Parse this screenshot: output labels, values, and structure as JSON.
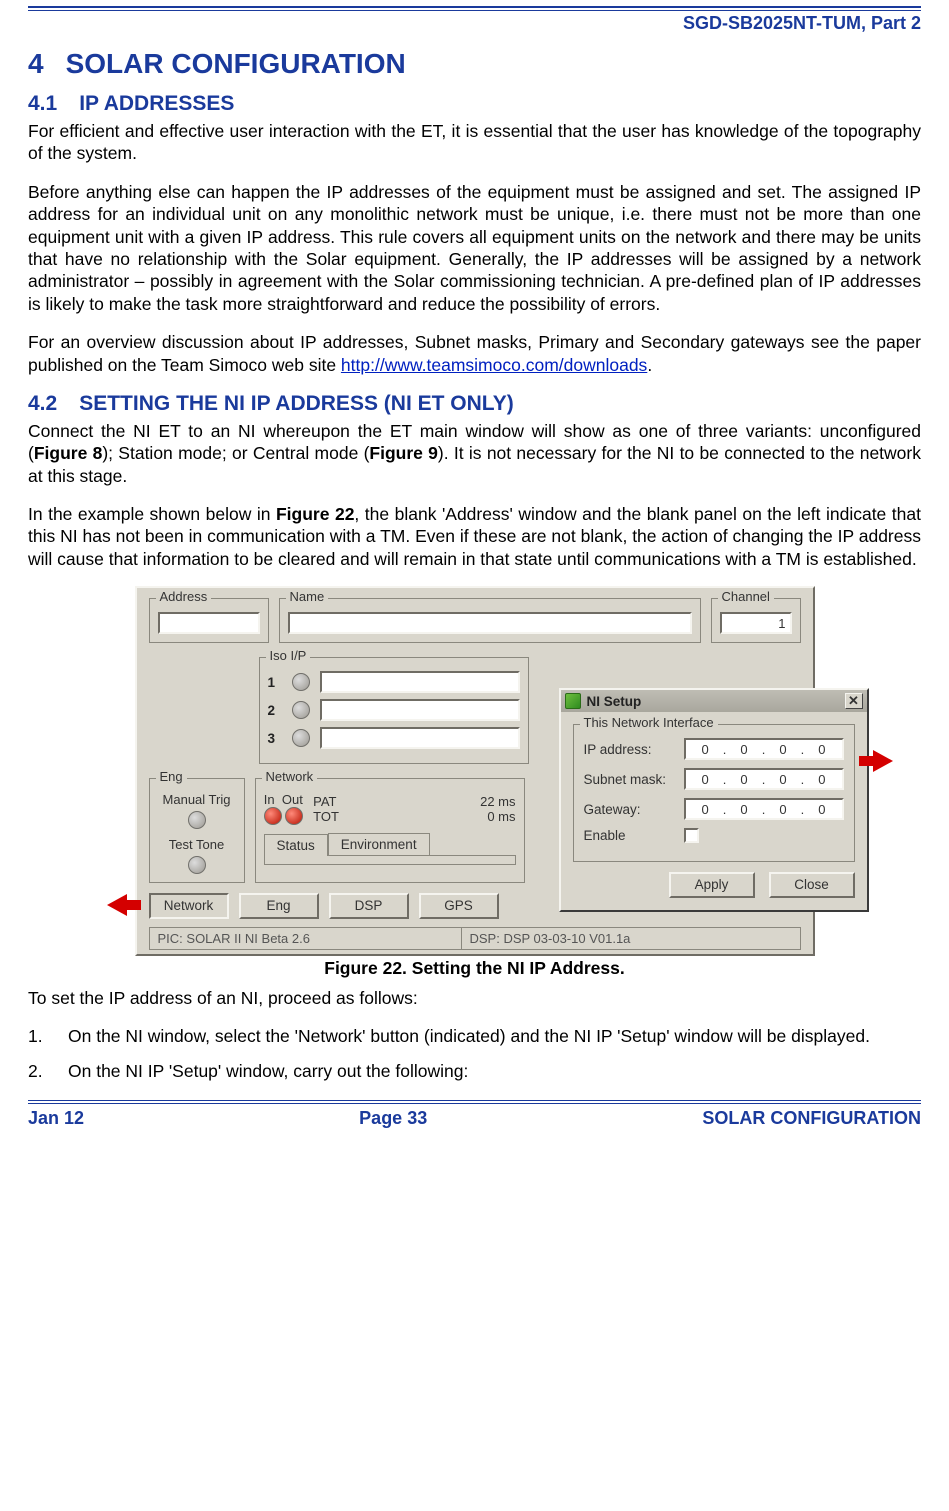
{
  "header": {
    "doc_id": "SGD-SB2025NT-TUM, Part 2"
  },
  "h1": {
    "num": "4",
    "title": "SOLAR CONFIGURATION"
  },
  "s41": {
    "num": "4.1",
    "title_a": "IP A",
    "title_b": "DDRESSES",
    "p1": "For efficient and effective user interaction with the ET, it is essential that the user has knowledge of the topography of the system.",
    "p2": "Before anything else can happen the IP addresses of the equipment must be assigned and set. The assigned IP address for an individual unit on any monolithic network must be unique, i.e. there must not be more than one equipment unit with a given IP address.  This rule covers all equipment units on the network and there may be units that have no relationship with the Solar equipment. Generally, the IP addresses will be assigned by a network administrator – possibly in agreement with the Solar commissioning technician.  A pre-defined plan of IP addresses is likely to make the task more straightforward and reduce the possibility of errors.",
    "p3a": "For an overview discussion about IP addresses, Subnet masks, Primary and Secondary gateways see the paper published on the Team Simoco web site ",
    "p3b_link": "http://www.teamsimoco.com/downloads",
    "p3c": "."
  },
  "s42": {
    "num": "4.2",
    "title_a": "S",
    "title_b": "ETTING ",
    "title_c": "T",
    "title_d": "HE ",
    "title_e": "NI IP A",
    "title_f": "DDRESS ",
    "title_g": "(NI ET O",
    "title_h": "NLY",
    "title_i": ")",
    "p1a": "Connect the NI ET to an NI whereupon the ET main window will show as one of three variants: unconfigured (",
    "p1b": "Figure 8",
    "p1c": "); Station mode; or Central mode (",
    "p1d": "Figure 9",
    "p1e": ").  It is not necessary for the NI to be connected to the network at this stage.",
    "p2a": "In the example shown below in ",
    "p2b": "Figure 22",
    "p2c": ", the blank 'Address' window and the blank panel on the left indicate that this NI has not been in communication with a TM.  Even if these are not blank, the action of changing the IP address will cause that information to be cleared and will remain in that state until communications with a TM is established."
  },
  "figure": {
    "caption": "Figure 22.  Setting the NI IP Address.",
    "groups": {
      "address": "Address",
      "name": "Name",
      "channel": "Channel",
      "channel_value": "1",
      "iso": "Iso I/P",
      "iso_rows": [
        "1",
        "2",
        "3"
      ],
      "eng_group": "Eng",
      "manual_trig": "Manual Trig",
      "test_tone": "Test Tone",
      "network": "Network",
      "net_in": "In",
      "net_out": "Out",
      "pat": "PAT",
      "pat_val": "22 ms",
      "tot": "TOT",
      "tot_val": "0 ms",
      "status_tab": "Status",
      "env_tab": "Environment"
    },
    "buttons": {
      "network": "Network",
      "eng": "Eng",
      "dsp": "DSP",
      "gps": "GPS"
    },
    "statusbar": {
      "pic": "PIC: SOLAR II NI Beta 2.6",
      "dsp": "DSP: DSP 03-03-10 V01.1a"
    },
    "ni_dialog": {
      "title": "NI Setup",
      "group": "This Network Interface",
      "ip_label": "IP address:",
      "subnet_label": "Subnet mask:",
      "gateway_label": "Gateway:",
      "enable_label": "Enable",
      "ip": [
        "0",
        "0",
        "0",
        "0"
      ],
      "subnet": [
        "0",
        "0",
        "0",
        "0"
      ],
      "gateway": [
        "0",
        "0",
        "0",
        "0"
      ],
      "apply": "Apply",
      "close": "Close"
    }
  },
  "after_fig": {
    "p": "To set the IP address of an NI, proceed as follows:",
    "step1": "On the NI window, select the 'Network' button (indicated) and the NI IP 'Setup' window will be displayed.",
    "step2": "On the NI IP 'Setup' window, carry out the following:"
  },
  "footer": {
    "left": "Jan 12",
    "center": "Page 33",
    "right": "SOLAR CONFIGURATION"
  }
}
